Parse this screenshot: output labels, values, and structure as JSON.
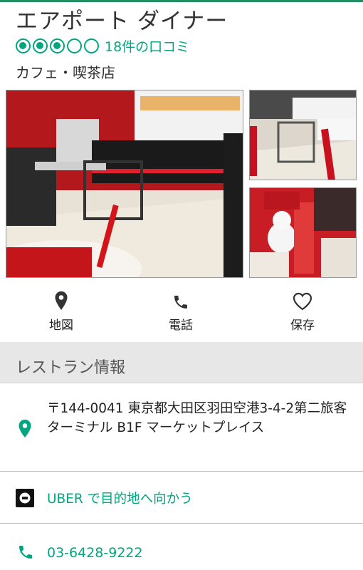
{
  "restaurant": {
    "name": "エアポート ダイナー",
    "rating_bubbles": 3,
    "rating_bubbles_total": 5,
    "reviews": "18件の口コミ",
    "category": "カフェ・喫茶店"
  },
  "actions": {
    "map_label": "地図",
    "call_label": "電話",
    "save_label": "保存"
  },
  "info": {
    "section_title": "レストラン情報",
    "address": "〒144-0041 東京都大田区羽田空港3-4-2第二旅客ターミナル B1F マーケットプレイス",
    "uber_label": "UBER で目的地へ向かう",
    "phone": "03-6428-9222"
  },
  "colors": {
    "accent": "#00a680",
    "topline": "#1f8f62",
    "section_bg": "#e7e7e7"
  },
  "icons": {
    "map": "map-pin-icon",
    "call": "phone-icon",
    "save": "heart-icon",
    "address": "location-pin-icon",
    "uber": "uber-icon",
    "phone": "phone-icon"
  }
}
